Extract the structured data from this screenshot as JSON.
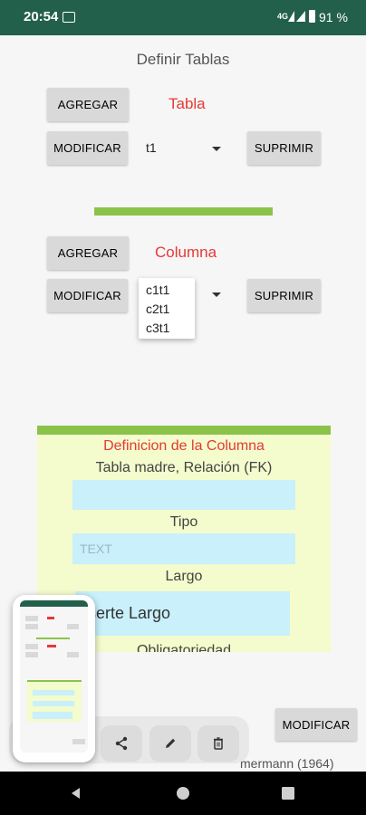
{
  "status": {
    "time": "20:54",
    "network": "4G",
    "battery": "91 %"
  },
  "page_title": "Definir Tablas",
  "tabla": {
    "label": "Tabla",
    "add": "AGREGAR",
    "modify": "MODIFICAR",
    "delete": "SUPRIMIR",
    "selected": "t1"
  },
  "columna": {
    "label": "Columna",
    "add": "AGREGAR",
    "modify": "MODIFICAR",
    "delete": "SUPRIMIR",
    "options": [
      "c1t1",
      "c2t1",
      "c3t1"
    ]
  },
  "definicion": {
    "title": "Definicion de la Columna",
    "fk_label": "Tabla madre, Relación (FK)",
    "fk_value": "",
    "tipo_label": "Tipo",
    "tipo_value": "TEXT",
    "largo_label": "Largo",
    "largo_placeholder": "serte Largo",
    "obligatoriedad_label": "Obligatoriedad"
  },
  "bottom": {
    "modify": "MODIFICAR",
    "credit": "mermann (1964)"
  },
  "colors": {
    "status_bar": "#23604b",
    "accent_green": "#8bc34a",
    "label_red": "#e53935",
    "panel_bg": "#f4fbcc",
    "field_bg": "#c9f0fb"
  }
}
